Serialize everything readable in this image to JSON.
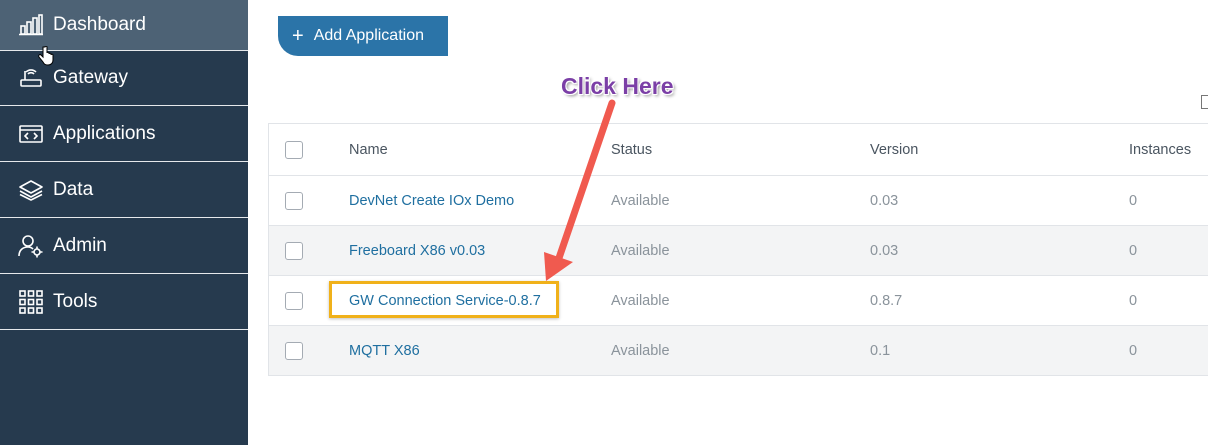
{
  "sidebar": {
    "items": [
      {
        "label": "Dashboard",
        "icon": "bar-chart-icon",
        "active": true
      },
      {
        "label": "Gateway",
        "icon": "router-icon",
        "active": false
      },
      {
        "label": "Applications",
        "icon": "code-window-icon",
        "active": false
      },
      {
        "label": "Data",
        "icon": "layers-icon",
        "active": false
      },
      {
        "label": "Admin",
        "icon": "user-gear-icon",
        "active": false
      },
      {
        "label": "Tools",
        "icon": "grid-icon",
        "active": false
      }
    ]
  },
  "toolbar": {
    "add_label": "Add Application",
    "add_icon": "plus-icon"
  },
  "annotation": {
    "callout": "Click Here",
    "highlight_color": "#f0b11a",
    "arrow_color": "#f05a4f"
  },
  "table": {
    "columns": [
      "Name",
      "Status",
      "Version",
      "Instances"
    ],
    "rows": [
      {
        "name": "DevNet Create IOx Demo",
        "status": "Available",
        "version": "0.03",
        "instances": "0"
      },
      {
        "name": "Freeboard X86 v0.03",
        "status": "Available",
        "version": "0.03",
        "instances": "0"
      },
      {
        "name": "GW Connection Service-0.8.7",
        "status": "Available",
        "version": "0.8.7",
        "instances": "0"
      },
      {
        "name": "MQTT X86",
        "status": "Available",
        "version": "0.1",
        "instances": "0"
      }
    ]
  },
  "colors": {
    "sidebar_bg": "#263a4e",
    "sidebar_active": "#4d6275",
    "button": "#2b74a8",
    "link": "#1f6fa0"
  }
}
